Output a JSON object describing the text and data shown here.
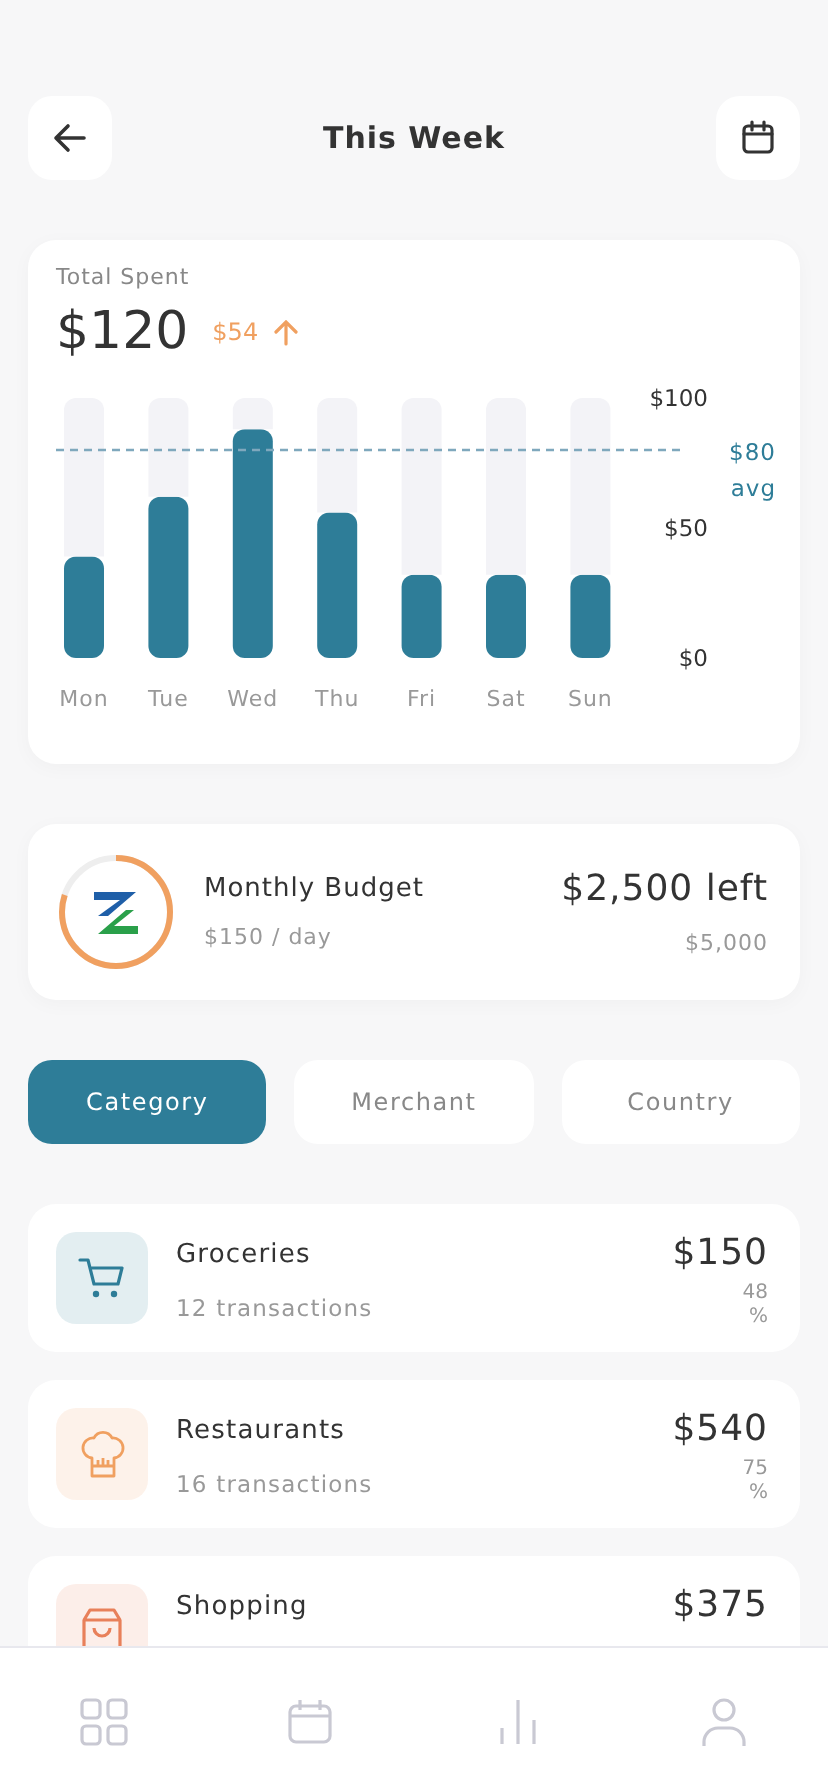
{
  "header": {
    "title": "This Week"
  },
  "spending": {
    "label": "Total Spent",
    "total": "$120",
    "change": "$54",
    "chart_data": {
      "type": "bar",
      "categories": [
        "Mon",
        "Tue",
        "Wed",
        "Thu",
        "Fri",
        "Sat",
        "Sun"
      ],
      "stacked": true,
      "series": [
        {
          "color": "#2e7d98",
          "values": [
            39,
            62,
            88,
            56,
            32,
            32,
            32
          ]
        },
        {
          "color": "#f3f3f7",
          "values": [
            61,
            38,
            12,
            44,
            68,
            68,
            68
          ]
        }
      ],
      "ylim": [
        0,
        100
      ],
      "yticks": [
        {
          "value": 0,
          "label": "$0"
        },
        {
          "value": 50,
          "label": "$50"
        },
        {
          "value": 100,
          "label": "$100"
        }
      ],
      "ref_lines": [
        {
          "axis": "y",
          "value": 80,
          "label": "$80 avg",
          "color": "#7fa8bd"
        }
      ]
    }
  },
  "budget": {
    "title": "Monthly Budget",
    "per_day": "$150 / day",
    "left": "$2,500 left",
    "total": "$5,000",
    "level": 0.8
  },
  "tabs": [
    {
      "label": "Category",
      "selected": true
    },
    {
      "label": "Merchant",
      "selected": false
    },
    {
      "label": "Country",
      "selected": false
    }
  ],
  "categories": [
    {
      "kind": "cart",
      "color": "#2e7d98",
      "name": "Groceries",
      "transactions": "12 transactions",
      "amount": "$150",
      "share": "48 %"
    },
    {
      "kind": "chef",
      "color": "#f0a060",
      "name": "Restaurants",
      "transactions": "16 transactions",
      "amount": "$540",
      "share": "75 %"
    },
    {
      "kind": "bag",
      "color": "#e8805a",
      "name": "Shopping",
      "amount": "$375"
    }
  ],
  "nav": [
    {
      "kind": "grid"
    },
    {
      "kind": "calendar"
    },
    {
      "kind": "chart"
    },
    {
      "kind": "person"
    }
  ]
}
